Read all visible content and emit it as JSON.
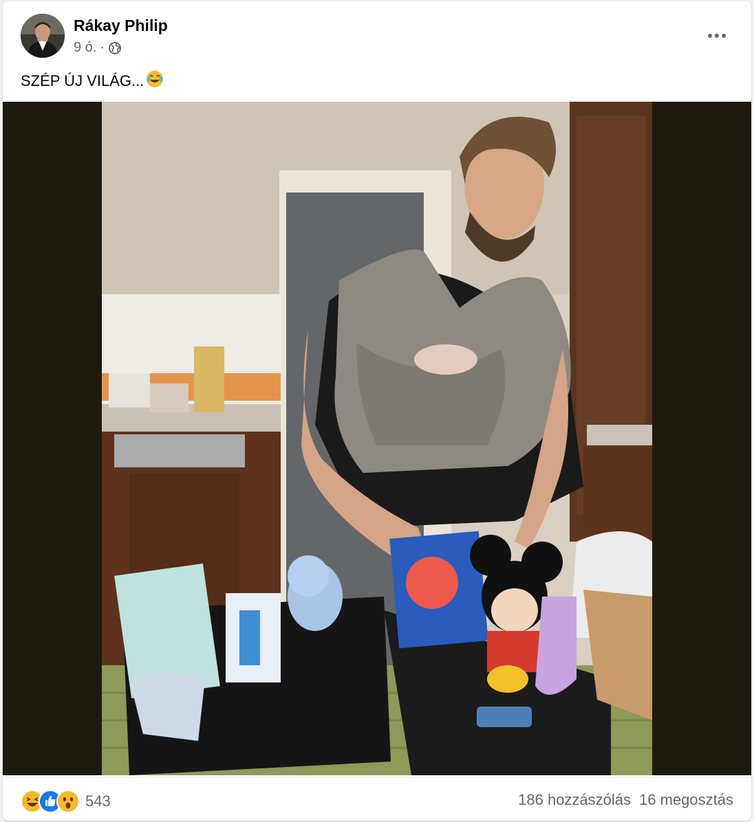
{
  "post": {
    "author": "Rákay Philip",
    "time": "9 ó.",
    "separator": "·",
    "text": "SZÉP ÚJ VILÁG...",
    "text_emoji": "crying-laughing-emoji"
  },
  "photo": {
    "alt": "photo"
  },
  "footer": {
    "reaction_icons": [
      "haha-icon",
      "like-icon",
      "wow-icon"
    ],
    "reaction_count": "543",
    "comments": "186 hozzászólás",
    "shares": "16 megosztás"
  },
  "colors": {
    "like_blue": "#1877f2",
    "reaction_yellow": "#f7b928",
    "secondary_text": "#65676b",
    "primary_text": "#050505",
    "media_bg": "#1f1a0f"
  }
}
